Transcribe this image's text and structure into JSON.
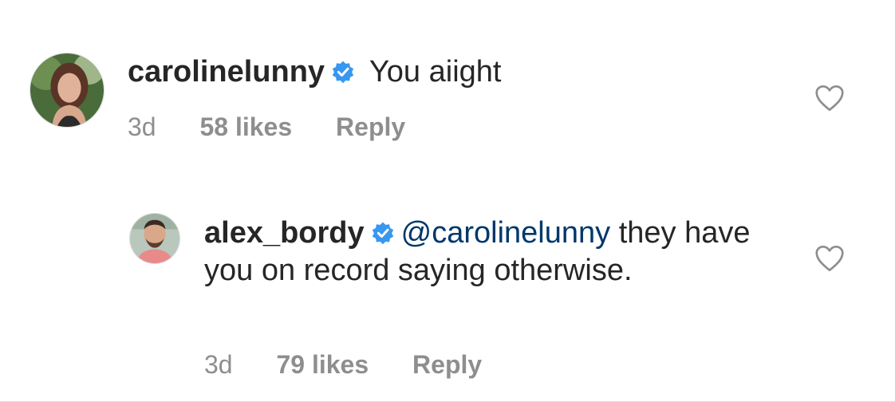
{
  "comments": [
    {
      "username": "carolinelunny",
      "verified": true,
      "mention": "",
      "text": " You aiight",
      "time": "3d",
      "likes": "58 likes",
      "reply_label": "Reply"
    },
    {
      "username": "alex_bordy",
      "verified": true,
      "mention": "@carolinelunny",
      "text": " they have you on record saying otherwise.",
      "time": "3d",
      "likes": "79 likes",
      "reply_label": "Reply"
    }
  ],
  "icons": {
    "verified": "verified-badge-icon",
    "like": "heart-icon"
  },
  "colors": {
    "verified_blue": "#3897f0",
    "mention_blue": "#00376b",
    "meta_gray": "#8e8e8e",
    "text": "#262626"
  }
}
